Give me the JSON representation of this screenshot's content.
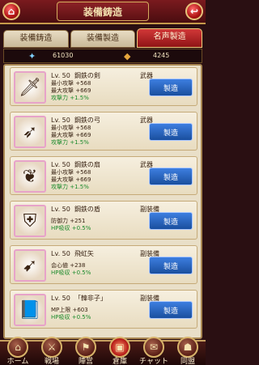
{
  "header": {
    "title": "装備鋳造",
    "home_glyph": "⌂",
    "back_glyph": "↩"
  },
  "tabs": [
    {
      "label": "装備鋳造",
      "active": false
    },
    {
      "label": "装備製造",
      "active": false
    },
    {
      "label": "名声製造",
      "active": true
    }
  ],
  "resources": {
    "left": {
      "icon": "crystal-icon",
      "glyph": "✦",
      "value": "61030"
    },
    "right": {
      "icon": "coin-bag-icon",
      "glyph": "◆",
      "value": "4245"
    }
  },
  "craft_label": "製造",
  "items": [
    {
      "level": "Lv. 50",
      "name": "鋼鉄の剣",
      "category": "武器",
      "icon": "sword-icon",
      "glyph": "🗡",
      "stats": [
        {
          "text": "最小攻撃 +568",
          "green": false
        },
        {
          "text": "最大攻撃 +669",
          "green": false
        },
        {
          "text": "攻撃力 +1.5%",
          "green": true
        }
      ]
    },
    {
      "level": "Lv. 50",
      "name": "鋼鉄の弓",
      "category": "武器",
      "icon": "bow-icon",
      "glyph": "➶",
      "stats": [
        {
          "text": "最小攻撃 +568",
          "green": false
        },
        {
          "text": "最大攻撃 +669",
          "green": false
        },
        {
          "text": "攻撃力 +1.5%",
          "green": true
        }
      ]
    },
    {
      "level": "Lv. 50",
      "name": "鋼鉄の扇",
      "category": "武器",
      "icon": "fan-icon",
      "glyph": "❦",
      "stats": [
        {
          "text": "最小攻撃 +568",
          "green": false
        },
        {
          "text": "最大攻撃 +669",
          "green": false
        },
        {
          "text": "攻撃力 +1.5%",
          "green": true
        }
      ]
    },
    {
      "level": "Lv. 50",
      "name": "鋼鉄の盾",
      "category": "副装備",
      "icon": "shield-icon",
      "glyph": "⛨",
      "stats": [
        {
          "text": "防御力 +251",
          "green": false
        },
        {
          "text": "HP吸収 +0.5%",
          "green": true
        }
      ]
    },
    {
      "level": "Lv. 50",
      "name": "飛虹矢",
      "category": "副装備",
      "icon": "quiver-icon",
      "glyph": "➹",
      "stats": [
        {
          "text": "会心値 +238",
          "green": false
        },
        {
          "text": "HP吸収 +0.5%",
          "green": true
        }
      ]
    },
    {
      "level": "Lv. 50",
      "name": "「韓非子」",
      "category": "副装備",
      "icon": "book-icon",
      "glyph": "📘",
      "stats": [
        {
          "text": "MP上限 +603",
          "green": false
        },
        {
          "text": "HP吸収 +0.5%",
          "green": true
        }
      ]
    }
  ],
  "nav": [
    {
      "label": "ホーム",
      "icon": "home-icon",
      "glyph": "⌂"
    },
    {
      "label": "戦場",
      "icon": "battlefield-icon",
      "glyph": "⚔"
    },
    {
      "label": "陣営",
      "icon": "camp-icon",
      "glyph": "⚑"
    },
    {
      "label": "倉庫",
      "icon": "warehouse-icon",
      "glyph": "▣"
    },
    {
      "label": "チャット",
      "icon": "chat-icon",
      "glyph": "✉"
    },
    {
      "label": "同盟",
      "icon": "alliance-icon",
      "glyph": "☗"
    }
  ]
}
